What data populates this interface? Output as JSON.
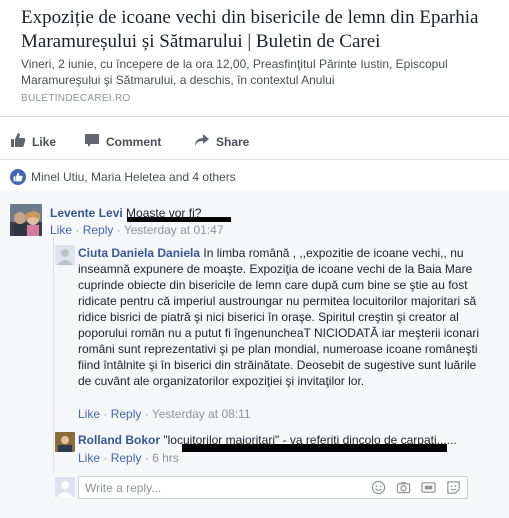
{
  "link_preview": {
    "title": "Expoziție de icoane vechi din bisericile de lemn din Eparhia Maramureșului și Sătmarului | Buletin de Carei",
    "description": "Vineri, 2 iunie, cu începere de la ora 12,00, Preasfinţitul Părinte Iustin, Episcopul Maramureşului şi Sătmarului, a deschis, în contextul Anului",
    "domain": "BULETINDECAREI.RO"
  },
  "actions": {
    "like": "Like",
    "comment": "Comment",
    "share": "Share"
  },
  "reactions": {
    "text": "Minel Utiu, Maria Heletea and 4 others"
  },
  "comments": [
    {
      "author": "Levente Levi",
      "text": "Moaste vor fi?",
      "like": "Like",
      "reply": "Reply",
      "time": "Yesterday at 01:47",
      "sep1": "·",
      "sep2": "·"
    }
  ],
  "replies": [
    {
      "author": "Ciuta Daniela Daniela",
      "text": "In limba română , ,,expozitie de icoane vechi,, nu inseamnă expunere de moaşte. Expoziţia de icoane vechi de la Baia Mare cuprinde obiecte din bisericile de lemn care după cum bine se ştie au fost ridicate pentru că imperiul austroungar nu permitea locuitorilor majoritari să ridice bisrici de piatră şi nici biserici în oraşe. Spiritul creştin şi creator al poporului român nu a putut fi îngenuncheaT NICIODATĂ iar meşterii iconari români sunt reprezentativi şi pe plan mondial, numeroase icoane româneşti fiind întâlnite şi în biserici din străinătate. Deosebit de sugestive sunt luările de cuvânt ale organizatorilor expoziţiei şi invitaţilor lor.",
      "like": "Like",
      "reply": "Reply",
      "time": "Yesterday at 08:11"
    },
    {
      "author": "Rolland Bokor",
      "text": "\"locuitorilor majoritari\" - va referiti dincolo de carpati......",
      "like": "Like",
      "reply": "Reply",
      "time": "6 hrs"
    }
  ],
  "reply_input": {
    "placeholder": "Write a reply..."
  },
  "colors": {
    "facebook_blue": "#4267b2",
    "name_blue": "#365899",
    "meta_gray": "#90949c"
  }
}
